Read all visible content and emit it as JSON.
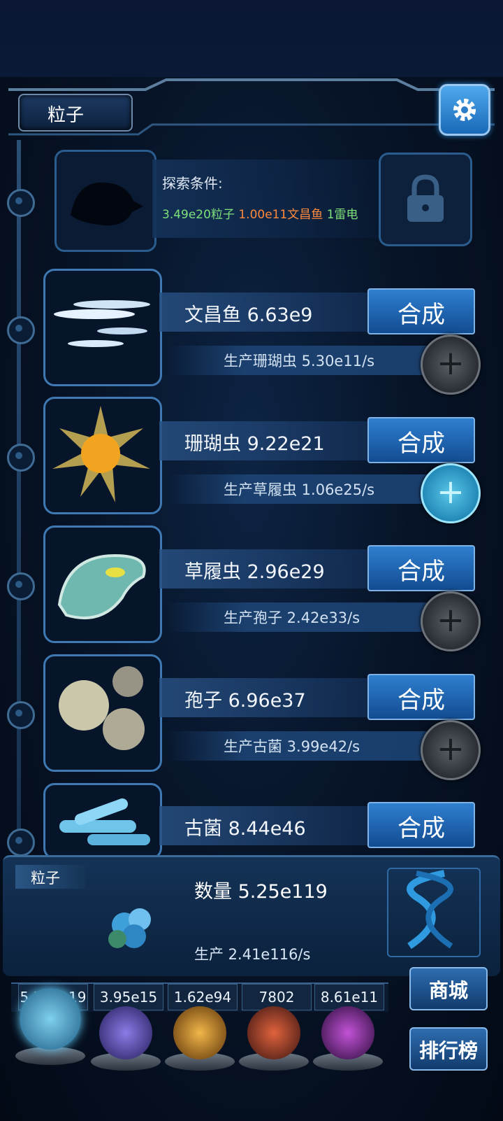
{
  "header": {
    "title": "粒子"
  },
  "locked": {
    "condition_title": "探索条件:",
    "req1": "3.49e20粒子",
    "req2": "1.00e11文昌鱼",
    "req3": "1雷电"
  },
  "units": [
    {
      "name": "文昌鱼 6.63e9",
      "production": "生产珊瑚虫 5.30e11/s",
      "synth_label": "合成",
      "plus_active": false
    },
    {
      "name": "珊瑚虫 9.22e21",
      "production": "生产草履虫 1.06e25/s",
      "synth_label": "合成",
      "plus_active": true
    },
    {
      "name": "草履虫 2.96e29",
      "production": "生产孢子 2.42e33/s",
      "synth_label": "合成",
      "plus_active": false
    },
    {
      "name": "孢子 6.96e37",
      "production": "生产古菌 3.99e42/s",
      "synth_label": "合成",
      "plus_active": false
    },
    {
      "name": "古菌 8.44e46",
      "production": "",
      "synth_label": "合成",
      "plus_active": false
    }
  ],
  "plus_symbol": "+",
  "summary": {
    "tag": "粒子",
    "count": "数量 5.25e119",
    "production": "生产 2.41e116/s"
  },
  "resources": [
    "5.25e119",
    "3.95e15",
    "1.62e94",
    "7802",
    "8.61e11"
  ],
  "side_buttons": {
    "shop": "商城",
    "rank": "排行榜"
  },
  "colors": {
    "req1": "#7ee07a",
    "req2": "#ff8a3d",
    "req3": "#7ee07a",
    "accent": "#2f7fd0"
  }
}
